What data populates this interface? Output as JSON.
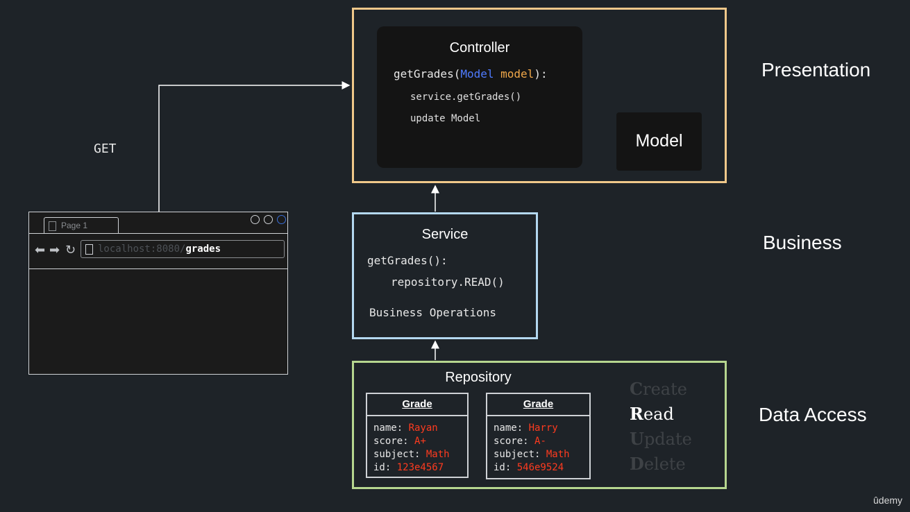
{
  "browser": {
    "tab_label": "Page 1",
    "url_host": "localhost:8080/",
    "url_path": "grades",
    "nav_icons": [
      "back-arrow-icon",
      "forward-arrow-icon",
      "reload-icon"
    ]
  },
  "request": {
    "method": "GET"
  },
  "controller": {
    "title": "Controller",
    "signature_fn": "getGrades(",
    "signature_type": "Model",
    "signature_var": "model",
    "signature_end": "):",
    "lines": [
      "service.getGrades()",
      "update Model"
    ]
  },
  "model": {
    "label": "Model"
  },
  "service": {
    "title": "Service",
    "signature": "getGrades():",
    "call": "repository.READ()",
    "operations": "Business Operations"
  },
  "repository": {
    "title": "Repository",
    "grades": [
      {
        "header": "Grade",
        "name": "Rayan",
        "score": "A+",
        "subject": "Math",
        "id": "123e4567"
      },
      {
        "header": "Grade",
        "name": "Harry",
        "score": "A-",
        "subject": "Math",
        "id": "546e9524"
      }
    ],
    "field_labels": {
      "name": "name: ",
      "score": "score: ",
      "subject": "subject: ",
      "id": "id: "
    }
  },
  "crud": [
    {
      "initial": "C",
      "rest": "reate",
      "active": false
    },
    {
      "initial": "R",
      "rest": "ead",
      "active": true
    },
    {
      "initial": "U",
      "rest": "pdate",
      "active": false
    },
    {
      "initial": "D",
      "rest": "elete",
      "active": false
    }
  ],
  "layers": {
    "presentation": "Presentation",
    "business": "Business",
    "data_access": "Data Access"
  },
  "watermark": "ûdemy",
  "colors": {
    "presentation_border": "#f0c88a",
    "service_border": "#b4d8f0",
    "repository_border": "#b6d68f",
    "type_blue": "#4f7bff",
    "var_orange": "#f2a94a",
    "value_red": "#ff3b1f"
  }
}
